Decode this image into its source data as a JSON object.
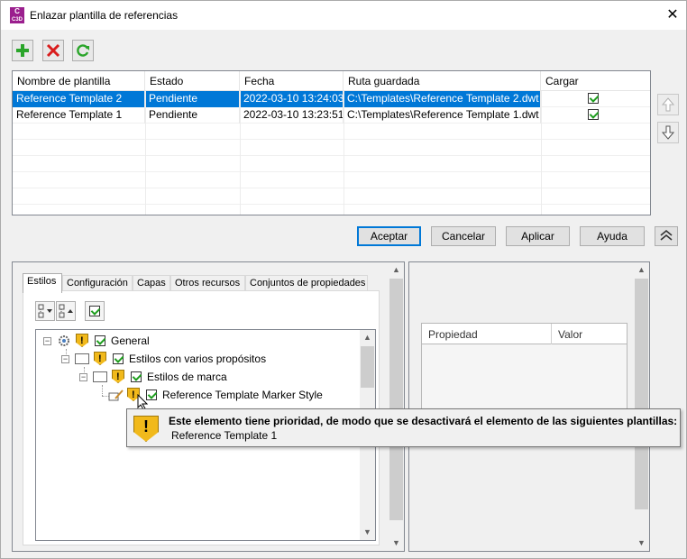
{
  "window": {
    "title": "Enlazar plantilla de referencias",
    "app_icon_text": "C",
    "app_icon_subtext": "C3D",
    "close_glyph": "✕"
  },
  "toolbar": {
    "add_icon": "plus-icon",
    "delete_icon": "delete-x-icon",
    "refresh_icon": "refresh-icon"
  },
  "templates_table": {
    "columns": [
      "Nombre de plantilla",
      "Estado",
      "Fecha",
      "Ruta guardada",
      "Cargar"
    ],
    "rows": [
      {
        "name": "Reference Template 2",
        "status": "Pendiente",
        "date": "2022-03-10 13:24:03",
        "path": "C:\\Templates\\Reference Template 2.dwt",
        "load": true,
        "selected": true
      },
      {
        "name": "Reference Template 1",
        "status": "Pendiente",
        "date": "2022-03-10 13:23:51",
        "path": "C:\\Templates\\Reference Template 1.dwt",
        "load": true,
        "selected": false
      }
    ]
  },
  "side_buttons": {
    "up_icon": "arrow-up-icon",
    "down_icon": "arrow-down-icon"
  },
  "buttons": {
    "accept": "Aceptar",
    "cancel": "Cancelar",
    "apply": "Aplicar",
    "help": "Ayuda",
    "collapse_icon": "double-chevron-up-icon"
  },
  "tabs": [
    "Estilos",
    "Configuración",
    "Capas",
    "Otros recursos",
    "Conjuntos de propiedades"
  ],
  "active_tab": "Estilos",
  "tree": {
    "nodes": [
      {
        "label": "General",
        "level": 0
      },
      {
        "label": "Estilos con varios propósitos",
        "level": 1
      },
      {
        "label": "Estilos de marca",
        "level": 2
      },
      {
        "label": "Reference Template Marker Style",
        "level": 3
      }
    ]
  },
  "properties": {
    "columns": [
      "Propiedad",
      "Valor"
    ]
  },
  "tooltip": {
    "title": "Este elemento tiene prioridad, de modo que se desactivará el elemento de las siguientes plantillas:",
    "item": "Reference Template 1"
  },
  "colors": {
    "selection": "#0078d7",
    "warning": "#f1b91b",
    "add_green": "#2aa52a",
    "delete_red": "#d91c1c"
  }
}
